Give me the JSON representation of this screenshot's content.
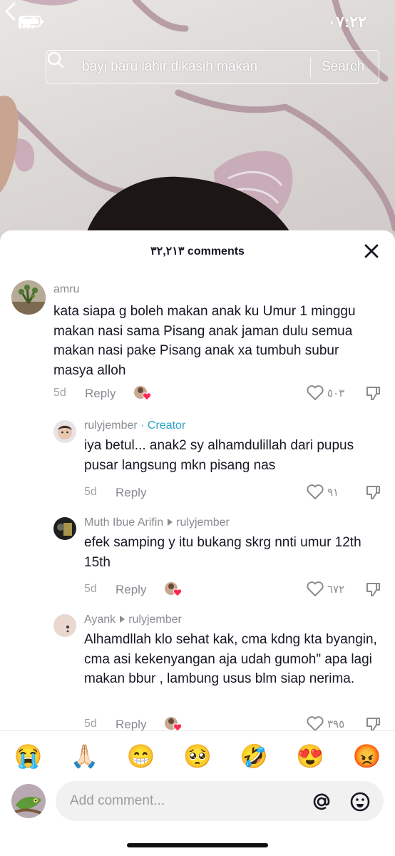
{
  "status_bar": {
    "time": "٠٧:٢٢"
  },
  "search": {
    "query": "bayi baru lahir dikasih makan",
    "button_label": "Search"
  },
  "comments_sheet": {
    "count_label": "٣٢,٢١٣ comments"
  },
  "comments": [
    {
      "username": "amru",
      "text": "kata siapa g boleh makan anak ku Umur 1 minggu makan nasi sama Pisang anak jaman dulu semua makan nasi pake Pisang anak xa tumbuh subur masya alloh",
      "date": "5d",
      "reply_label": "Reply",
      "likes": "٥٠٣"
    },
    {
      "username": "rulyjember",
      "badge": "· Creator",
      "text": "iya betul... anak2 sy alhamdulillah dari pupus pusar langsung mkn pisang nas",
      "date": "5d",
      "reply_label": "Reply",
      "likes": "٩١"
    },
    {
      "username": "Muth Ibue Arifin",
      "reply_to": "rulyjember",
      "text": "efek samping y itu bukang skrg nnti umur 12th 15th",
      "date": "5d",
      "reply_label": "Reply",
      "likes": "٦٧٢"
    },
    {
      "username": "Ayank",
      "reply_to": "rulyjember",
      "text": "Alhamdllah klo sehat kak, cma kdng kta byangin, cma asi kekenyangan aja udah gumoh\" apa lagi makan bbur , lambung usus blm siap nerima.",
      "date": "5d",
      "reply_label": "Reply",
      "likes": "٣٩٥"
    }
  ],
  "emoji_bar": [
    "😭",
    "🙏🏻",
    "😁",
    "🥺",
    "🤣",
    "😍",
    "😡"
  ],
  "input": {
    "placeholder": "Add comment..."
  },
  "colors": {
    "creator": "#2aa3c6",
    "text": "#161823",
    "muted": "#8a8b91"
  }
}
